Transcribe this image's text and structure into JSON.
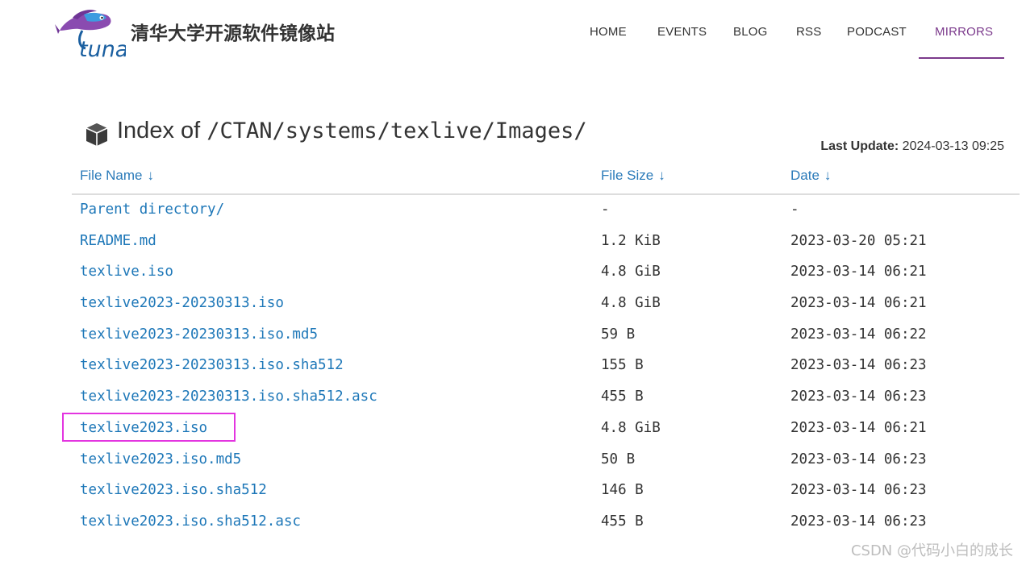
{
  "header": {
    "logo_text": "tuna",
    "site_title": "清华大学开源软件镜像站",
    "nav": [
      {
        "label": "HOME",
        "active": false
      },
      {
        "label": "EVENTS",
        "active": false
      },
      {
        "label": "BLOG",
        "active": false
      },
      {
        "label": "RSS",
        "active": false
      },
      {
        "label": "PODCAST",
        "active": false
      },
      {
        "label": "MIRRORS",
        "active": true
      }
    ],
    "colors": {
      "active": "#7b3a8c",
      "text": "#333333"
    }
  },
  "page": {
    "title_prefix": "Index of",
    "title_path": "/CTAN/systems/texlive/Images/",
    "title_icon": "box-icon",
    "last_update_label": "Last Update:",
    "last_update_value": "2024-03-13 09:25"
  },
  "table": {
    "headers": [
      {
        "label": "File Name",
        "arrow": "↓"
      },
      {
        "label": "File Size",
        "arrow": "↓"
      },
      {
        "label": "Date",
        "arrow": "↓"
      }
    ],
    "rows": [
      {
        "name": "Parent directory/",
        "size": "-",
        "date": "-"
      },
      {
        "name": "README.md",
        "size": "1.2 KiB",
        "date": "2023-03-20 05:21"
      },
      {
        "name": "texlive.iso",
        "size": "4.8 GiB",
        "date": "2023-03-14 06:21"
      },
      {
        "name": "texlive2023-20230313.iso",
        "size": "4.8 GiB",
        "date": "2023-03-14 06:21"
      },
      {
        "name": "texlive2023-20230313.iso.md5",
        "size": "59 B",
        "date": "2023-03-14 06:22"
      },
      {
        "name": "texlive2023-20230313.iso.sha512",
        "size": "155 B",
        "date": "2023-03-14 06:23"
      },
      {
        "name": "texlive2023-20230313.iso.sha512.asc",
        "size": "455 B",
        "date": "2023-03-14 06:23"
      },
      {
        "name": "texlive2023.iso",
        "size": "4.8 GiB",
        "date": "2023-03-14 06:21",
        "highlighted": true
      },
      {
        "name": "texlive2023.iso.md5",
        "size": "50 B",
        "date": "2023-03-14 06:23"
      },
      {
        "name": "texlive2023.iso.sha512",
        "size": "146 B",
        "date": "2023-03-14 06:23"
      },
      {
        "name": "texlive2023.iso.sha512.asc",
        "size": "455 B",
        "date": "2023-03-14 06:23"
      }
    ],
    "colors": {
      "link": "#1d77b8",
      "header": "#2a7ab9",
      "highlight": "#e335e0"
    }
  },
  "watermark": "CSDN @代码小白的成长"
}
